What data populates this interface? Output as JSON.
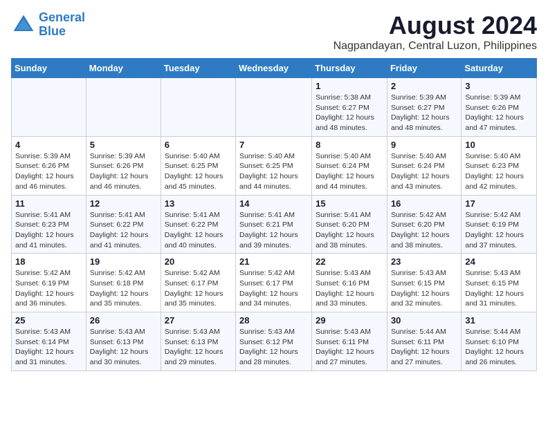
{
  "header": {
    "logo_line1": "General",
    "logo_line2": "Blue",
    "month_title": "August 2024",
    "location": "Nagpandayan, Central Luzon, Philippines"
  },
  "days_of_week": [
    "Sunday",
    "Monday",
    "Tuesday",
    "Wednesday",
    "Thursday",
    "Friday",
    "Saturday"
  ],
  "weeks": [
    [
      {
        "day": "",
        "info": ""
      },
      {
        "day": "",
        "info": ""
      },
      {
        "day": "",
        "info": ""
      },
      {
        "day": "",
        "info": ""
      },
      {
        "day": "1",
        "info": "Sunrise: 5:38 AM\nSunset: 6:27 PM\nDaylight: 12 hours\nand 48 minutes."
      },
      {
        "day": "2",
        "info": "Sunrise: 5:39 AM\nSunset: 6:27 PM\nDaylight: 12 hours\nand 48 minutes."
      },
      {
        "day": "3",
        "info": "Sunrise: 5:39 AM\nSunset: 6:26 PM\nDaylight: 12 hours\nand 47 minutes."
      }
    ],
    [
      {
        "day": "4",
        "info": "Sunrise: 5:39 AM\nSunset: 6:26 PM\nDaylight: 12 hours\nand 46 minutes."
      },
      {
        "day": "5",
        "info": "Sunrise: 5:39 AM\nSunset: 6:26 PM\nDaylight: 12 hours\nand 46 minutes."
      },
      {
        "day": "6",
        "info": "Sunrise: 5:40 AM\nSunset: 6:25 PM\nDaylight: 12 hours\nand 45 minutes."
      },
      {
        "day": "7",
        "info": "Sunrise: 5:40 AM\nSunset: 6:25 PM\nDaylight: 12 hours\nand 44 minutes."
      },
      {
        "day": "8",
        "info": "Sunrise: 5:40 AM\nSunset: 6:24 PM\nDaylight: 12 hours\nand 44 minutes."
      },
      {
        "day": "9",
        "info": "Sunrise: 5:40 AM\nSunset: 6:24 PM\nDaylight: 12 hours\nand 43 minutes."
      },
      {
        "day": "10",
        "info": "Sunrise: 5:40 AM\nSunset: 6:23 PM\nDaylight: 12 hours\nand 42 minutes."
      }
    ],
    [
      {
        "day": "11",
        "info": "Sunrise: 5:41 AM\nSunset: 6:23 PM\nDaylight: 12 hours\nand 41 minutes."
      },
      {
        "day": "12",
        "info": "Sunrise: 5:41 AM\nSunset: 6:22 PM\nDaylight: 12 hours\nand 41 minutes."
      },
      {
        "day": "13",
        "info": "Sunrise: 5:41 AM\nSunset: 6:22 PM\nDaylight: 12 hours\nand 40 minutes."
      },
      {
        "day": "14",
        "info": "Sunrise: 5:41 AM\nSunset: 6:21 PM\nDaylight: 12 hours\nand 39 minutes."
      },
      {
        "day": "15",
        "info": "Sunrise: 5:41 AM\nSunset: 6:20 PM\nDaylight: 12 hours\nand 38 minutes."
      },
      {
        "day": "16",
        "info": "Sunrise: 5:42 AM\nSunset: 6:20 PM\nDaylight: 12 hours\nand 38 minutes."
      },
      {
        "day": "17",
        "info": "Sunrise: 5:42 AM\nSunset: 6:19 PM\nDaylight: 12 hours\nand 37 minutes."
      }
    ],
    [
      {
        "day": "18",
        "info": "Sunrise: 5:42 AM\nSunset: 6:19 PM\nDaylight: 12 hours\nand 36 minutes."
      },
      {
        "day": "19",
        "info": "Sunrise: 5:42 AM\nSunset: 6:18 PM\nDaylight: 12 hours\nand 35 minutes."
      },
      {
        "day": "20",
        "info": "Sunrise: 5:42 AM\nSunset: 6:17 PM\nDaylight: 12 hours\nand 35 minutes."
      },
      {
        "day": "21",
        "info": "Sunrise: 5:42 AM\nSunset: 6:17 PM\nDaylight: 12 hours\nand 34 minutes."
      },
      {
        "day": "22",
        "info": "Sunrise: 5:43 AM\nSunset: 6:16 PM\nDaylight: 12 hours\nand 33 minutes."
      },
      {
        "day": "23",
        "info": "Sunrise: 5:43 AM\nSunset: 6:15 PM\nDaylight: 12 hours\nand 32 minutes."
      },
      {
        "day": "24",
        "info": "Sunrise: 5:43 AM\nSunset: 6:15 PM\nDaylight: 12 hours\nand 31 minutes."
      }
    ],
    [
      {
        "day": "25",
        "info": "Sunrise: 5:43 AM\nSunset: 6:14 PM\nDaylight: 12 hours\nand 31 minutes."
      },
      {
        "day": "26",
        "info": "Sunrise: 5:43 AM\nSunset: 6:13 PM\nDaylight: 12 hours\nand 30 minutes."
      },
      {
        "day": "27",
        "info": "Sunrise: 5:43 AM\nSunset: 6:13 PM\nDaylight: 12 hours\nand 29 minutes."
      },
      {
        "day": "28",
        "info": "Sunrise: 5:43 AM\nSunset: 6:12 PM\nDaylight: 12 hours\nand 28 minutes."
      },
      {
        "day": "29",
        "info": "Sunrise: 5:43 AM\nSunset: 6:11 PM\nDaylight: 12 hours\nand 27 minutes."
      },
      {
        "day": "30",
        "info": "Sunrise: 5:44 AM\nSunset: 6:11 PM\nDaylight: 12 hours\nand 27 minutes."
      },
      {
        "day": "31",
        "info": "Sunrise: 5:44 AM\nSunset: 6:10 PM\nDaylight: 12 hours\nand 26 minutes."
      }
    ]
  ]
}
